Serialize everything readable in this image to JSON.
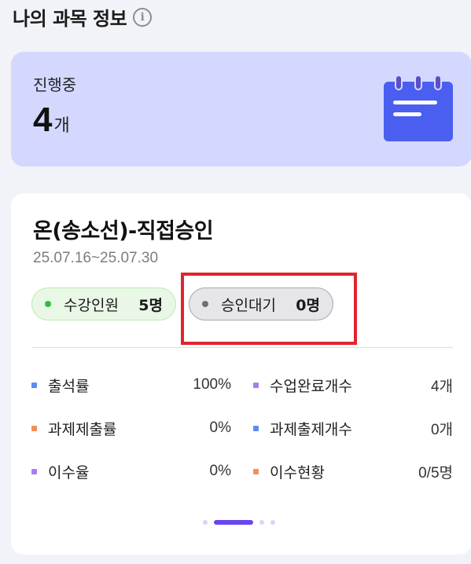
{
  "header": {
    "title": "나의 과목 정보",
    "info_icon": "info-circle-icon"
  },
  "summary": {
    "label": "진행중",
    "count": "4",
    "unit": "개",
    "icon": "calendar-icon",
    "colors": {
      "card_bg": "#d4d8ff",
      "icon": "#4a5ff0"
    }
  },
  "course": {
    "title": "온(송소선)-직접승인",
    "period": "25.07.16~25.07.30",
    "badges": {
      "enrolled": {
        "label": "수강인원",
        "count": "5명"
      },
      "pending": {
        "label": "승인대기",
        "count": "0명"
      }
    },
    "stats": [
      {
        "label": "출석률",
        "value": "100%",
        "color": "#5b8def"
      },
      {
        "label": "수업완료개수",
        "value": "4개",
        "color": "#a77ef0"
      },
      {
        "label": "과제제출률",
        "value": "0%",
        "color": "#f2905a"
      },
      {
        "label": "과제출제개수",
        "value": "0개",
        "color": "#5b8def"
      },
      {
        "label": "이수율",
        "value": "0%",
        "color": "#a77ef0"
      },
      {
        "label": "이수현황",
        "value": "0/5명",
        "color": "#f2905a"
      }
    ]
  },
  "pager": {
    "total": 4,
    "active_index": 1
  },
  "highlight_color": "#e0242e"
}
